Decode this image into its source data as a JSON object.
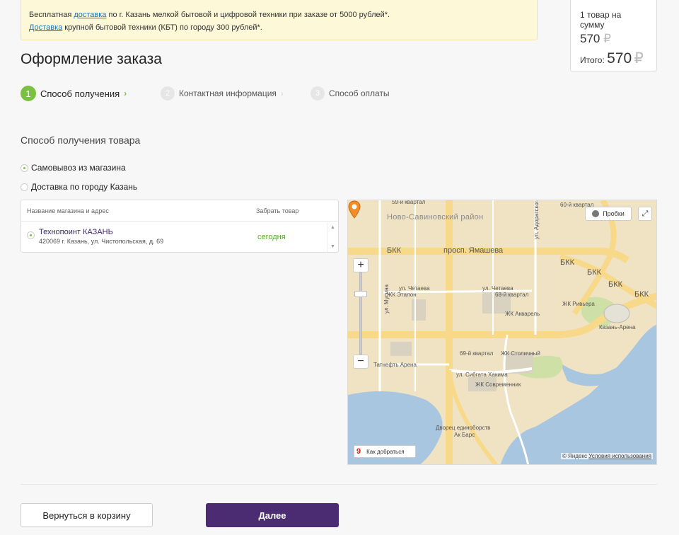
{
  "notice": {
    "line1_prefix": "Бесплатная ",
    "line1_link": "доставка",
    "line1_suffix": " по г. Казань мелкой бытовой и цифровой техники при заказе от 5000 рублей*.",
    "line2_link": "Доставка",
    "line2_suffix": " крупной бытовой техники (КБТ) по городу 300 рублей*."
  },
  "summary": {
    "count_text": "1 товар на сумму",
    "sum": "570",
    "currency": "₽",
    "total_label": "Итого:",
    "total": "570"
  },
  "page_title": "Оформление заказа",
  "steps": [
    {
      "num": "1",
      "label": "Способ получения",
      "active": true
    },
    {
      "num": "2",
      "label": "Контактная информация",
      "active": false
    },
    {
      "num": "3",
      "label": "Способ оплаты",
      "active": false
    }
  ],
  "step_arrow": "›",
  "delivery": {
    "section_title": "Способ получения товара",
    "options": [
      {
        "label": "Самовывоз из магазина",
        "selected": true
      },
      {
        "label": "Доставка по городу Казань",
        "selected": false
      }
    ]
  },
  "stores_table": {
    "col_store": "Название магазина и адрес",
    "col_pickup": "Забрать товар",
    "rows": [
      {
        "name": "Технопоинт КАЗАНЬ",
        "address": "420069 г. Казань, ул. Чистопольская, д. 69",
        "pickup": "сегодня",
        "selected": true
      }
    ]
  },
  "map": {
    "traffic_label": "Пробки",
    "route_label": "Как добраться",
    "copyright": "© Яндекс",
    "terms": "Условия использования",
    "labels": {
      "district": "Ново-Савиновский район",
      "bkk": "БКК",
      "yamasheva": "просп. Ямашева",
      "chetaeva": "ул. Четаева",
      "etalon": "ЖК Эталон",
      "q68": "68-й квартал",
      "akvarel": "ЖК Акварель",
      "riviera": "ЖК Ривьера",
      "arena": "Казань-Арена",
      "q69": "69-й квартал",
      "stolichny": "ЖК Столичный",
      "tatneft": "Татнефть Арена",
      "sibgata": "ул. Сибгата Хакима",
      "sovremennik": "ЖК Современник",
      "dvorets": "Дворец единоборств",
      "akbars": "Ак Барс",
      "adoratskogo": "ул. Адоратского",
      "musina": "ул. Мусина",
      "q59": "59-й квартал",
      "q60": "60-й квартал"
    }
  },
  "buttons": {
    "back": "Вернуться в корзину",
    "next": "Далее"
  },
  "colors": {
    "accent_green": "#7ac142",
    "primary_purple": "#4b2c73",
    "notice_bg": "#fdf8d8"
  }
}
